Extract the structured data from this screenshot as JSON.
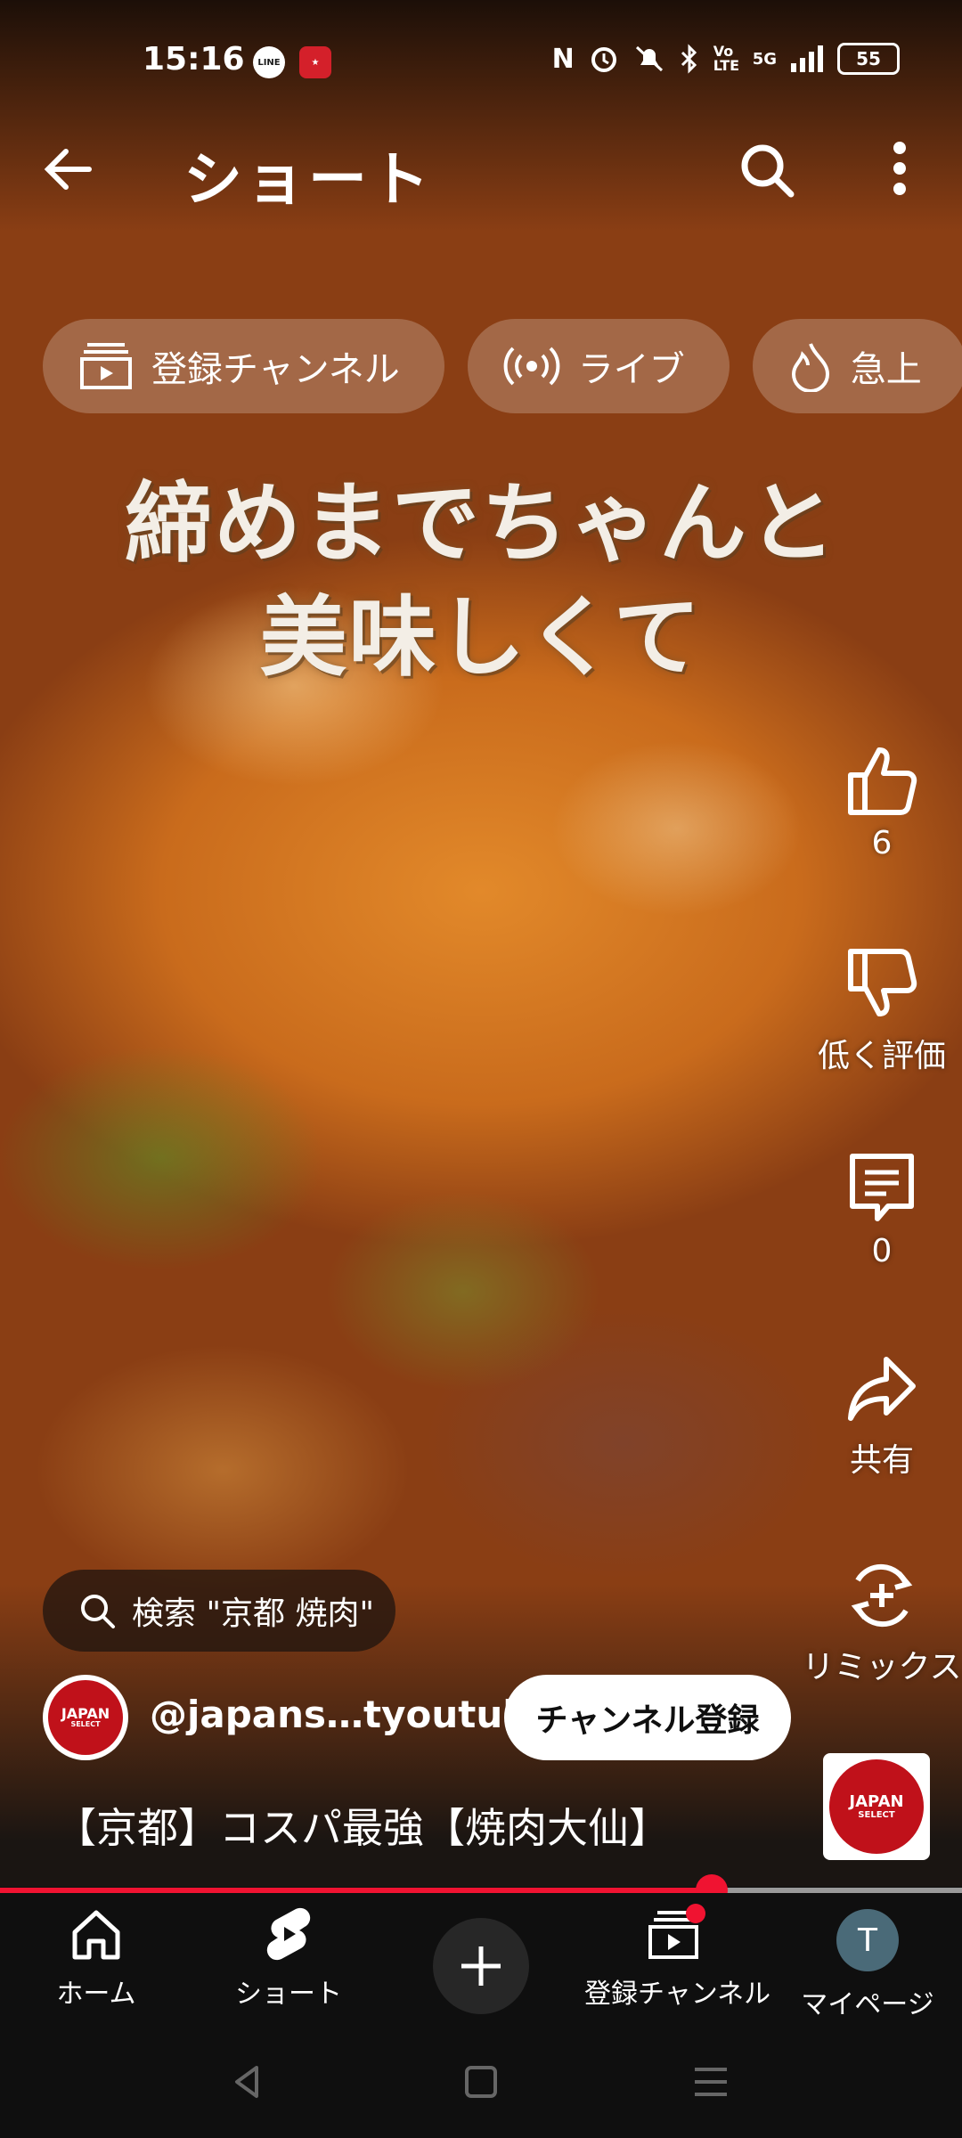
{
  "status": {
    "time": "15:16",
    "app_icons": [
      "LINE"
    ],
    "icons": [
      "nfc-icon",
      "alarm-icon",
      "mute-icon",
      "bluetooth-icon",
      "volte-icon",
      "signal-5g-icon"
    ],
    "network": "5G",
    "volte": "Vo LTE",
    "battery": "55"
  },
  "topbar": {
    "title": "ショート"
  },
  "chips": [
    {
      "label": "登録チャンネル",
      "icon": "subscriptions-icon"
    },
    {
      "label": "ライブ",
      "icon": "live-icon"
    },
    {
      "label": "急上",
      "icon": "trending-icon"
    }
  ],
  "video": {
    "overlay_line1": "締めまでちゃんと",
    "overlay_line2": "美味しくて"
  },
  "actions": {
    "like_count": "6",
    "dislike_label": "低く評価",
    "comment_count": "0",
    "share_label": "共有",
    "remix_label": "リミックス"
  },
  "query_pill": {
    "label": "検索 \"京都 焼肉\""
  },
  "channel": {
    "handle": "@japans…tyoutube",
    "subscribe_label": "チャンネル登録",
    "logo_text": "JAPAN",
    "logo_sub": "SELECT"
  },
  "video_title": "【京都】コスパ最強【焼肉大仙】",
  "progress": {
    "fraction": 0.74
  },
  "bottom_nav": {
    "home": "ホーム",
    "shorts": "ショート",
    "subscriptions": "登録チャンネル",
    "mypage": "マイページ",
    "profile_initial": "T"
  },
  "colors": {
    "accent": "#f01331",
    "background": "#0f0f0f",
    "logo_red": "#c0111a"
  }
}
